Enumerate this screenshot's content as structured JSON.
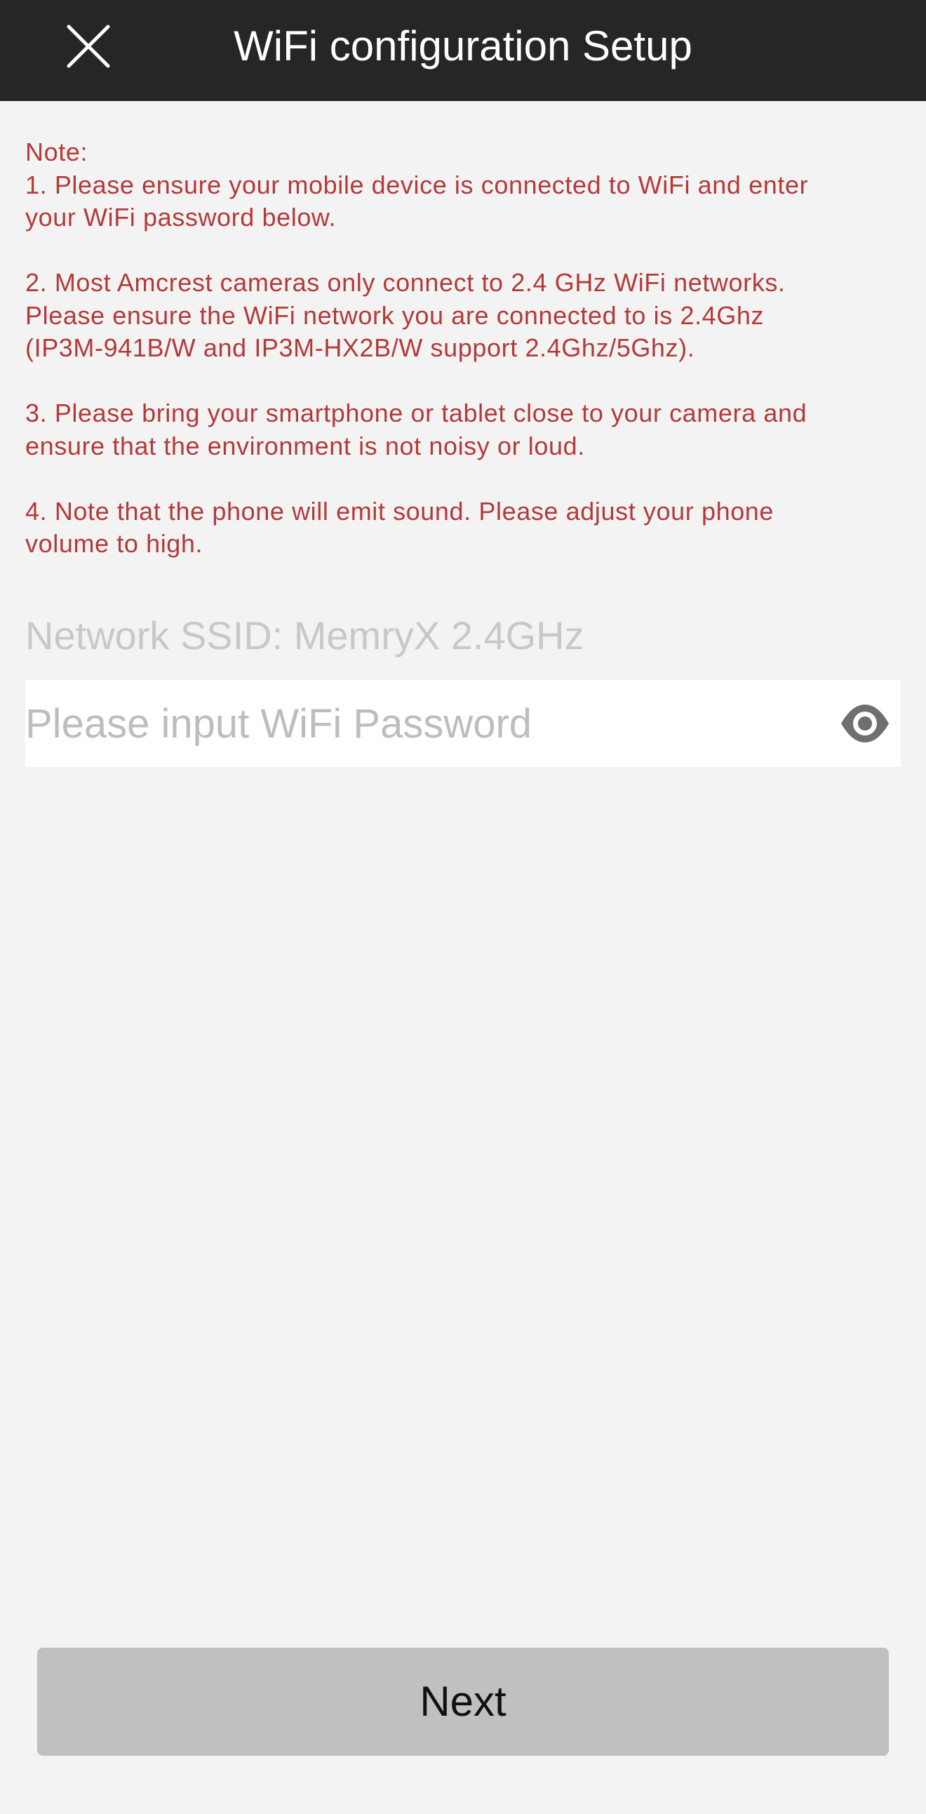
{
  "header": {
    "title": "WiFi configuration Setup",
    "close_icon": "close-icon"
  },
  "notes": {
    "heading": "Note:",
    "items": [
      [
        "1. Please ensure your mobile device is connected to WiFi and enter",
        "your WiFi password below."
      ],
      [
        "2. Most Amcrest cameras only connect to 2.4 GHz WiFi networks.",
        "Please ensure the WiFi network you are connected to is 2.4Ghz",
        "(IP3M-941B/W and IP3M-HX2B/W support 2.4Ghz/5Ghz)."
      ],
      [
        "3. Please bring your smartphone or tablet close to your camera and",
        "ensure that the environment is not noisy or loud."
      ],
      [
        "4. Note that the phone will emit sound. Please adjust your phone",
        "volume to high."
      ]
    ],
    "color": "#b43a3a"
  },
  "network": {
    "ssid_text": "Network SSID: MemryX 2.4GHz"
  },
  "password": {
    "placeholder": "Please input WiFi Password",
    "value": "",
    "toggle_icon": "eye-icon"
  },
  "footer": {
    "next_label": "Next"
  },
  "colors": {
    "nav_background": "#262626",
    "page_background": "#f3f3f3",
    "button_background": "#c0c0c0"
  }
}
